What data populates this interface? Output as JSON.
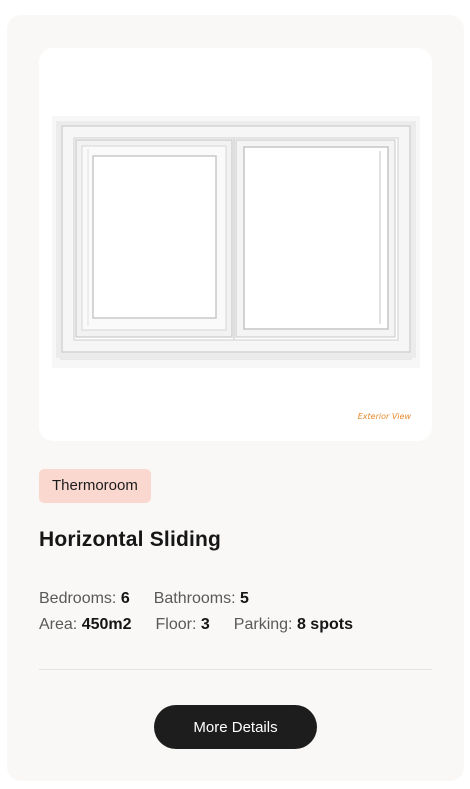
{
  "product": {
    "image": {
      "icon": "sliding-window-illustration",
      "caption": "Exterior View"
    },
    "tag": "Thermoroom",
    "title": "Horizontal Sliding",
    "specs": {
      "bedrooms": {
        "label": "Bedrooms:",
        "value": "6"
      },
      "bathrooms": {
        "label": "Bathrooms:",
        "value": "5"
      },
      "area": {
        "label": "Area:",
        "value": "450m2"
      },
      "floor": {
        "label": "Floor:",
        "value": "3"
      },
      "parking": {
        "label": "Parking:",
        "value": "8 spots"
      }
    },
    "cta_label": "More Details"
  },
  "colors": {
    "card_bg": "#f9f8f7",
    "tag_bg": "#fbd8cf",
    "button_bg": "#1d1d1d",
    "caption": "#e8892c"
  }
}
